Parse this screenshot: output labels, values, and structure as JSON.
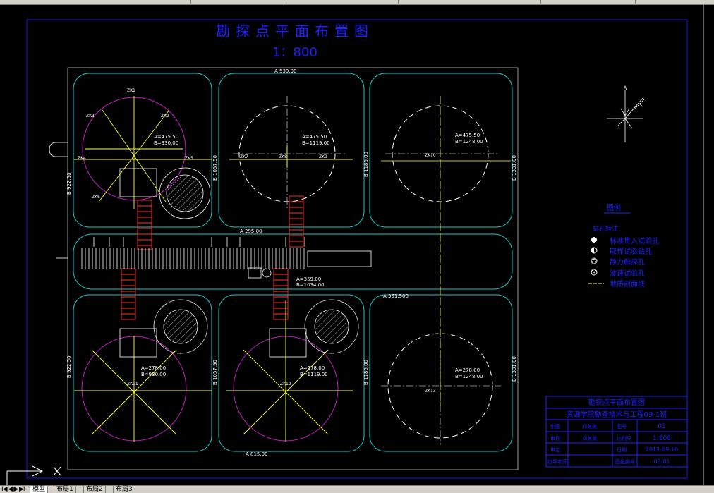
{
  "title": "勘探点平面布置图",
  "scale": "1：800",
  "dims": {
    "top": "A 539.90",
    "mid_left": "A 295.00",
    "bottom_mid": "A 351.500",
    "bottom_left": "A 815.00",
    "left1": "B 922.50",
    "left2": "B 922.50",
    "v1": "B 1057.50",
    "v2": "B 1186.00",
    "v3": "B 1331.00",
    "v4": "B 1057.50",
    "v5": "B 1186.00",
    "v6": "B 1331.00"
  },
  "coords": [
    {
      "a": "A=475.50",
      "b": "B=930.00"
    },
    {
      "a": "A=475.50",
      "b": "B=1119.00"
    },
    {
      "a": "A=475.50",
      "b": "B=1248.00"
    },
    {
      "a": "A=359.00",
      "b": "B=1034.00"
    },
    {
      "a": "A=278.00",
      "b": "B=930.00"
    },
    {
      "a": "A=278.00",
      "b": "B=1119.00"
    },
    {
      "a": "A=278.00",
      "b": "B=1248.00"
    }
  ],
  "legend": {
    "title": "图例",
    "subtitle": "钻孔标注",
    "items": [
      {
        "icon": "solid-circle-icon",
        "label": "标准贯入试验孔"
      },
      {
        "icon": "half-circle-icon",
        "label": "取样试验钻孔"
      },
      {
        "icon": "cone-circle-icon",
        "label": "静力触探孔"
      },
      {
        "icon": "cross-circle-icon",
        "label": "波速试验孔"
      },
      {
        "icon": "dashed-line-icon",
        "label": "地质剖面线"
      }
    ]
  },
  "title_block": {
    "drawing_title": "勘探点平面布置图",
    "school": "资源学院勘查技术与工程09-1班",
    "rows": [
      {
        "l1": "制图",
        "v1": "邓某某",
        "l2": "图号",
        "v2": "01"
      },
      {
        "l1": "审核",
        "v1": "邓某某",
        "l2": "比例尺",
        "v2": "1:800"
      },
      {
        "l1": "审定",
        "v1": "",
        "l2": "日期",
        "v2": "2013-09-10"
      },
      {
        "l1": "指导老师",
        "v1": "",
        "l2": "图纸编号",
        "v2": "02-01"
      }
    ]
  },
  "tabs": {
    "nav": "I◀ ◀ ▶ ▶I",
    "items": [
      "模型",
      "布局1",
      "布局2",
      "布局3"
    ],
    "active": 0
  },
  "colors": {
    "border": "#1515d8",
    "road": "#18c8c8",
    "tank": "#ffffff",
    "boring": "#ffff33",
    "spiral": "#ff3030",
    "circle": "#c020c0",
    "legend": "#2020ff"
  }
}
